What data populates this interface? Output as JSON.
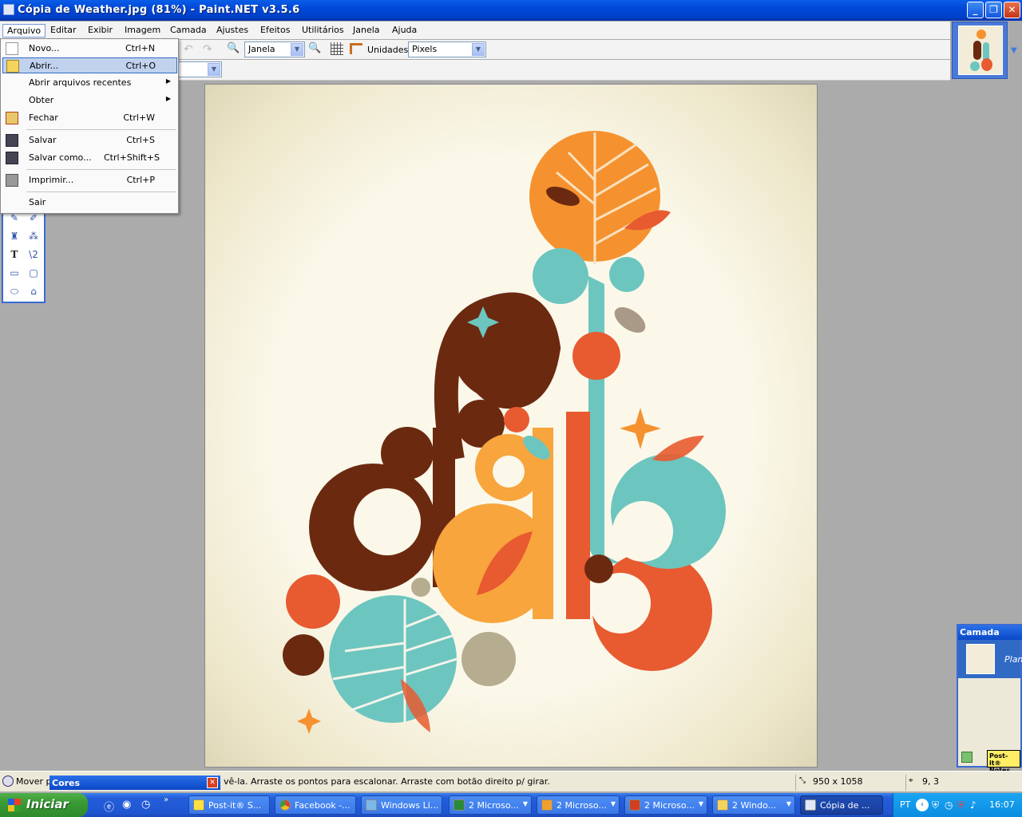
{
  "window": {
    "title": "Cópia de Weather.jpg (81%) - Paint.NET v3.5.6"
  },
  "menubar": [
    "Arquivo",
    "Editar",
    "Exibir",
    "Imagem",
    "Camada",
    "Ajustes",
    "Efeitos",
    "Utilitários",
    "Janela",
    "Ajuda"
  ],
  "toolbar": {
    "zoom_value": "Janela",
    "units_label": "Unidades",
    "units_value": "Pixels"
  },
  "file_menu": {
    "items": [
      {
        "label": "Novo...",
        "shortcut": "Ctrl+N"
      },
      {
        "label": "Abrir...",
        "shortcut": "Ctrl+O"
      },
      {
        "label": "Abrir arquivos recentes",
        "shortcut": ""
      },
      {
        "label": "Obter",
        "shortcut": ""
      },
      {
        "label": "Fechar",
        "shortcut": "Ctrl+W"
      },
      {
        "label": "Salvar",
        "shortcut": "Ctrl+S"
      },
      {
        "label": "Salvar como...",
        "shortcut": "Ctrl+Shift+S"
      },
      {
        "label": "Imprimir...",
        "shortcut": "Ctrl+P"
      },
      {
        "label": "Sair",
        "shortcut": ""
      }
    ]
  },
  "layers": {
    "title": "Camada",
    "layer_name": "Plan"
  },
  "colors_panel": {
    "title": "Cores"
  },
  "status": {
    "hint_left": "Mover pi",
    "hint_right": "vê-la. Arraste os pontos para escalonar. Arraste com botão direito p/ girar.",
    "image_size": "950 x 1058",
    "cursor_pos": "9, 3"
  },
  "taskbar": {
    "start": "Iniciar",
    "tasks": [
      "Post-it® S...",
      "Facebook -...",
      "Windows Li...",
      "2 Microso...",
      "2 Microso...",
      "2 Microso...",
      "2 Windo...",
      "Cópia de ..."
    ],
    "lang": "PT",
    "clock": "16:07"
  },
  "postit_label": "Post-it® Notes"
}
